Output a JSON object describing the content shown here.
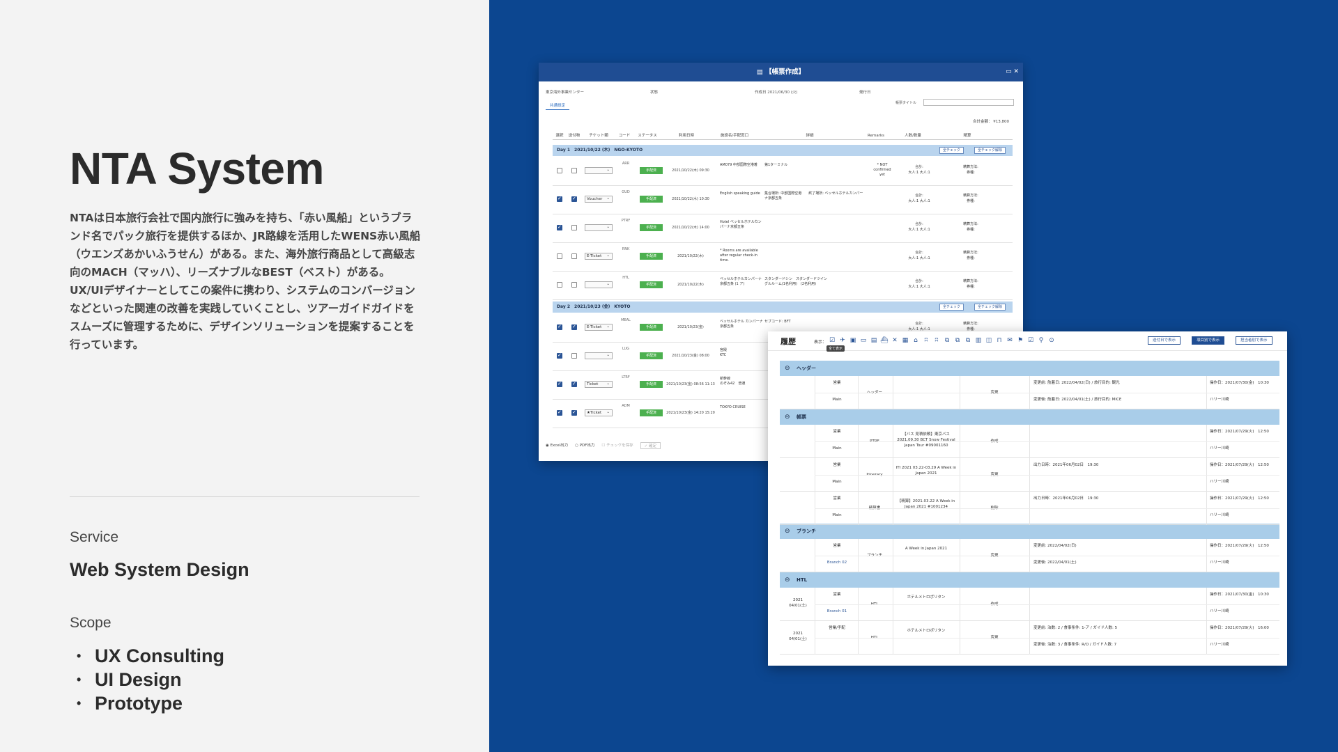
{
  "left": {
    "title": "NTA System",
    "description": "NTAは日本旅行会社で国内旅行に強みを持ち、「赤い風船」というブランド名でパック旅行を提供するほか、JR路線を活用したWENS赤い風船（ウエンズあかいふうせん）がある。また、海外旅行商品として高級志向のMACH（マッハ）、リーズナブルなBEST（ベスト）がある。UX/UIデザイナーとしてこの案件に携わり、システムのコンバージョンなどといった関連の改善を実践していくことし、ツアーガイドガイドをスムーズに管理するために、デザインソリューションを提案することを行っています。",
    "service_label": "Service",
    "service_value": "Web System Design",
    "scope_label": "Scope",
    "scope_items": [
      "UX Consulting",
      "UI Design",
      "Prototype"
    ]
  },
  "w1": {
    "title": "【帳票作成】",
    "meta1": "東京海外事業センター",
    "meta2": "状態",
    "meta3": "作成日 2021/06/30 (火)",
    "meta4": "発行日",
    "tab": "共通設定",
    "title_label": "帳票タイトル",
    "total": "合計金額： ¥13,800",
    "headers": [
      "選択",
      "送付物",
      "チケット類",
      "コード",
      "ステータス",
      "利用日時",
      "施設名/手配窓口",
      "詳細",
      "Remarks",
      "人数/数量",
      "精算"
    ],
    "day1": "Day 1　2021/10/22 (木)　NGO-KYOTO",
    "day2": "Day 2　2021/10/23 (金)　KYOTO",
    "check_all": "全チェック",
    "uncheck_all": "全チェック解除",
    "rows": [
      {
        "sel": "",
        "code": "ARR",
        "status": "手配済",
        "dt": "2021/10/22(木) 09:30",
        "nm": "AM079 中部国際空港着",
        "dtl": "第1ターミナル",
        "rm": "* NOT confirmed yet",
        "pp": "合計:\n大人:1 大人:1",
        "bk": "精算方法:\n券種:"
      },
      {
        "sel": "Voucher",
        "code": "GUD",
        "status": "手配済",
        "dt": "2021/10/22(木) 10:30",
        "nm": "English speaking guide",
        "dtl": "集合場所: 中部国際空港　　終了場所: ベッセルホテルカンパーナ京都五条",
        "rm": "",
        "pp": "合計:\n大人:1 大人:1",
        "bk": "精算方法:\n券種:"
      },
      {
        "sel": "",
        "code": "PTRF",
        "status": "手配済",
        "dt": "2021/10/22(木) 14:00",
        "nm": "Hotel ベッセルホテルカンパーナ京都五条",
        "dtl": "",
        "rm": "",
        "pp": "合計:\n大人:1 大人:1",
        "bk": "精算方法:\n券種:"
      },
      {
        "sel": "E-Ticket",
        "code": "RNK",
        "status": "手配済",
        "dt": "2021/10/22(木)",
        "nm": "* Rooms are available after regular check-in time.",
        "dtl": "",
        "rm": "",
        "pp": "合計:\n大人:1 大人:1",
        "bk": "精算方法:\n券種:"
      },
      {
        "sel": "",
        "code": "HTL",
        "status": "手配済",
        "dt": "2021/10/22(木)",
        "nm": "ベッセルホテルカンパーナ京都五条 (1 ア)",
        "dtl": "スタンダードシン　スタンダードツイン\nグルルーム(1名利用)　(2名利用)",
        "rm": "",
        "pp": "合計:\n大人:1 大人:1",
        "bk": "精算方法:\n券種:"
      },
      {
        "sel": "E-Ticket",
        "code": "MEAL",
        "status": "手配済",
        "dt": "2021/10/23(金)",
        "nm": "ベッセルホテル カンパーナ京都五条",
        "dtl": "セブコード: BFT",
        "rm": "",
        "pp": "合計:\n大人:1 大人:1",
        "bk": "精算方法:\n券種:"
      },
      {
        "sel": "",
        "code": "LUG",
        "status": "手配済",
        "dt": "2021/10/23(金) 08:00",
        "nm": "宮殿\nKTC",
        "dtl": "",
        "rm": "",
        "pp": "",
        "bk": ""
      },
      {
        "sel": "Ticket",
        "code": "LTRF",
        "status": "手配済",
        "dt": "2021/10/23(金) 08:56 11:13",
        "nm": "新幹線\nのぞみ42　普通",
        "dtl": "",
        "rm": "",
        "pp": "",
        "bk": ""
      },
      {
        "sel": "★Ticket",
        "code": "ADM",
        "status": "手配済",
        "dt": "2021/10/23(金) 14:20 15:20",
        "nm": "TOKYO CRUISE",
        "dtl": "",
        "rm": "",
        "pp": "",
        "bk": ""
      }
    ],
    "foot1": "Excel出力",
    "foot2": "PDF出力",
    "foot3": "チェックを保存",
    "foot4": "✓ 確定"
  },
  "w2": {
    "title": "履歴",
    "show_label": "表示：",
    "tooltip": "全て表示",
    "btn1": "送付日で表示",
    "btn2": "項目別で表示",
    "btn3": "担当者別で表示",
    "sections": [
      {
        "name": "ヘッダー"
      },
      {
        "name": "帳票"
      },
      {
        "name": "ブランチ"
      },
      {
        "name": "HTL"
      }
    ],
    "h_rows": [
      {
        "a": "営業",
        "b": "Main",
        "cat": "ヘッダー",
        "item": "",
        "op": "変更",
        "ch1": "変更前: 航着日: 2022/04/02(日) / 旅行目的: 観光",
        "ch2": "変更後: 航着日: 2022/04/01(土) / 旅行目的: MICE",
        "op1": "操作日：2021/07/30(金)　10:30",
        "op2": "ハリー川崎"
      },
      {
        "a": "営業",
        "b": "Main",
        "cat": "PTRF",
        "item": "【バス 見積依頼】東京バス 2021.09.30 BCT Snow Festival Japan Tour #09001160",
        "op": "作成",
        "ch1": "",
        "ch2": "",
        "op1": "操作日：2021/07/29(火)　12:50",
        "op2": "ハリー川崎"
      },
      {
        "a": "営業",
        "b": "Main",
        "cat": "Itinerary",
        "item": "ITI 2021 03.22-03.29 A Week in Japan 2021",
        "op": "変更",
        "ch1": "出力日時：2021年06月02日　19:30",
        "ch2": "",
        "op1": "操作日：2021/07/29(火)　12:50",
        "op2": "ハリー川崎"
      },
      {
        "a": "営業",
        "b": "Main",
        "cat": "精算書",
        "item": "【精算】2021.03.22 A Week in Japan 2021 #1001234",
        "op": "削除",
        "ch1": "出力日時：2021年06月02日　19:30",
        "ch2": "",
        "op1": "操作日：2021/07/29(火)　12:50",
        "op2": "ハリー川崎"
      },
      {
        "a": "営業",
        "b": "Branch 02",
        "cat": "ブランチ",
        "item": "A Week in Japan 2021",
        "op": "変更",
        "ch1": "変更前: 2022/04/02(日)",
        "ch2": "変更後: 2022/04/01(土)",
        "op1": "操作日：2021/07/29(火)　12:50",
        "op2": "ハリー川崎"
      },
      {
        "a": "営業",
        "b": "Branch 01",
        "pre": "2021\n04/01(土)",
        "cat": "HTL",
        "item": "ホテルメトロポリタン",
        "op": "作成",
        "ch1": "",
        "ch2": "",
        "op1": "操作日：2021/07/30(金)　10:30",
        "op2": "ハリー川崎"
      },
      {
        "a": "営業/手配",
        "b": "",
        "pre": "2021\n04/01(土)",
        "cat": "HTL",
        "item": "ホテルメトロポリタン",
        "op": "変更",
        "ch1": "変更前: 泊数: 2 / 食事条件: 1-ア / ガイド人数: 5",
        "ch2": "変更後: 泊数: 3 / 食事条件: R/O / ガイド人数: 7",
        "op1": "操作日：2021/07/29(火)　16:00",
        "op2": "ハリー川崎"
      }
    ]
  }
}
